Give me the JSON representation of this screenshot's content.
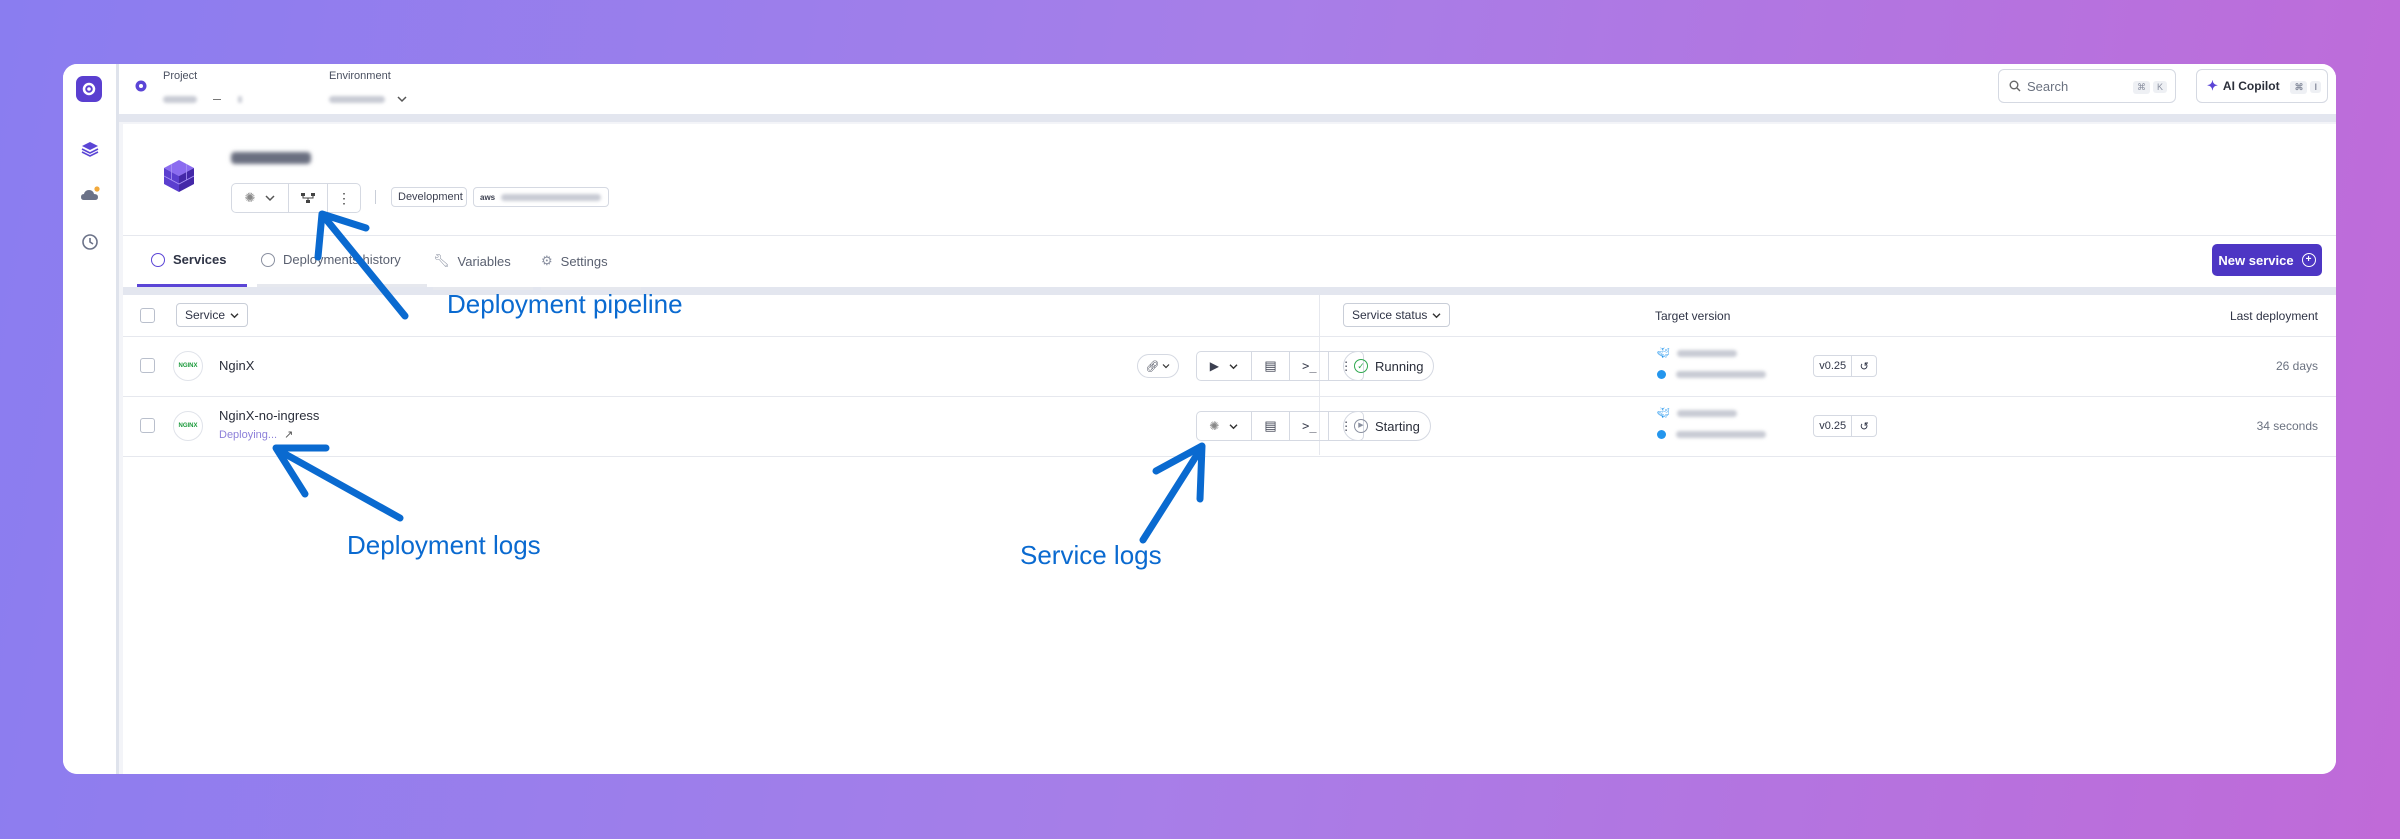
{
  "topbar": {
    "project_label": "Project",
    "environment_label": "Environment",
    "search_placeholder": "Search",
    "search_kbd": [
      "⌘",
      "K"
    ],
    "copilot_label": "AI Copilot",
    "copilot_kbd": [
      "⌘",
      "I"
    ]
  },
  "project": {
    "env_badge": "Development",
    "cloud_badge": "aws"
  },
  "tabs": [
    {
      "label": "Services"
    },
    {
      "label": "Deployments history"
    },
    {
      "label": "Variables"
    },
    {
      "label": "Settings"
    }
  ],
  "new_service_label": "New service",
  "table": {
    "service_filter": "Service",
    "status_filter": "Service status",
    "target_version_header": "Target version",
    "last_deployment_header": "Last deployment"
  },
  "services": [
    {
      "logo": "NGINX",
      "name": "NginX",
      "sub": "",
      "status": "Running",
      "version": "v0.25",
      "last_deployment": "26 days"
    },
    {
      "logo": "NGINX",
      "name": "NginX-no-ingress",
      "sub": "Deploying...",
      "status": "Starting",
      "version": "v0.25",
      "last_deployment": "34 seconds"
    }
  ],
  "annotations": {
    "pipeline": "Deployment pipeline",
    "deploy_logs": "Deployment logs",
    "service_logs": "Service logs"
  },
  "colors": {
    "accent": "#4d36c4",
    "annotation": "#0a6ad0",
    "running": "#2fa84f"
  }
}
